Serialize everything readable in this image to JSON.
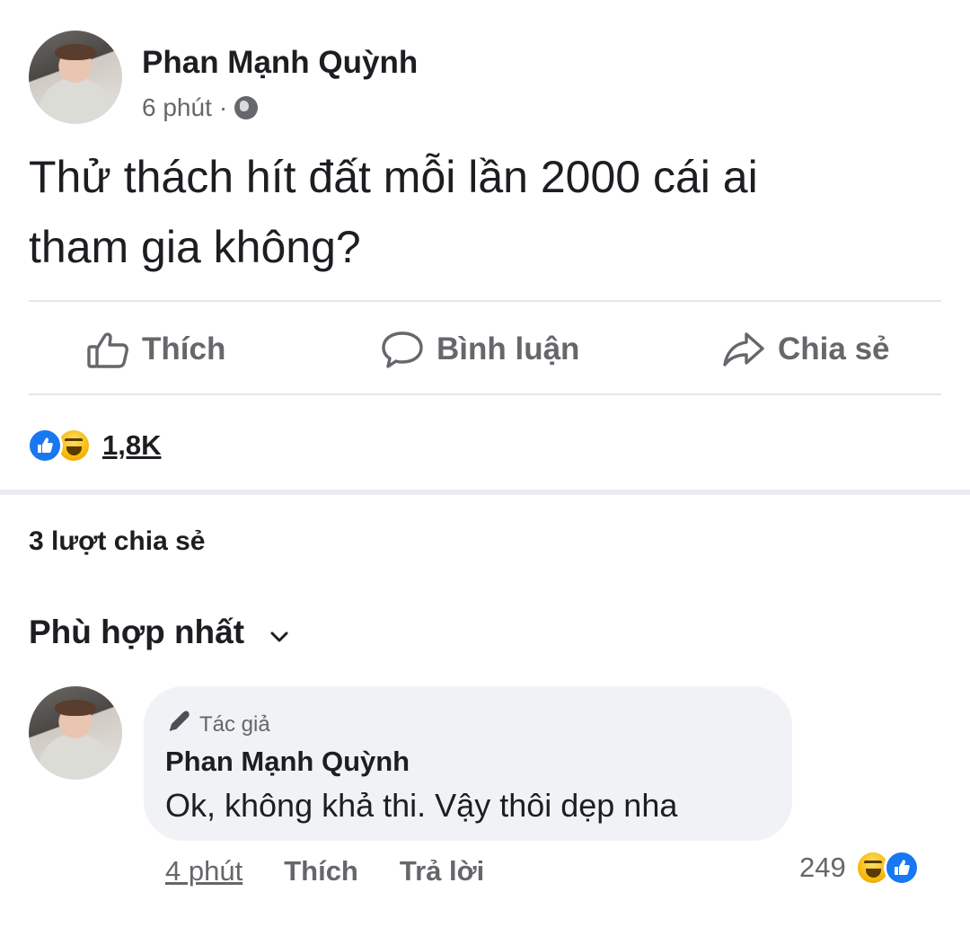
{
  "post": {
    "author": "Phan Mạnh Quỳnh",
    "time": "6 phút",
    "time_separator": "·",
    "privacy_icon": "globe-icon",
    "text_line1": "Thử thách hít đất mỗi lần 2000 cái ai",
    "text_line2": "tham gia không?"
  },
  "actions": {
    "like": "Thích",
    "comment": "Bình luận",
    "share": "Chia sẻ"
  },
  "reactions": {
    "types": [
      "like",
      "haha"
    ],
    "count": "1,8K",
    "like_color": "#1877f2"
  },
  "shares": "3 lượt chia sẻ",
  "comments_sort": "Phù hợp nhất",
  "comment": {
    "badge": "Tác giả",
    "author": "Phan Mạnh Quỳnh",
    "text": "Ok, không khả thi. Vậy thôi dẹp nha",
    "time": "4 phút",
    "like": "Thích",
    "reply": "Trả lời",
    "reaction_count": "249",
    "reaction_types": [
      "haha",
      "like"
    ]
  }
}
